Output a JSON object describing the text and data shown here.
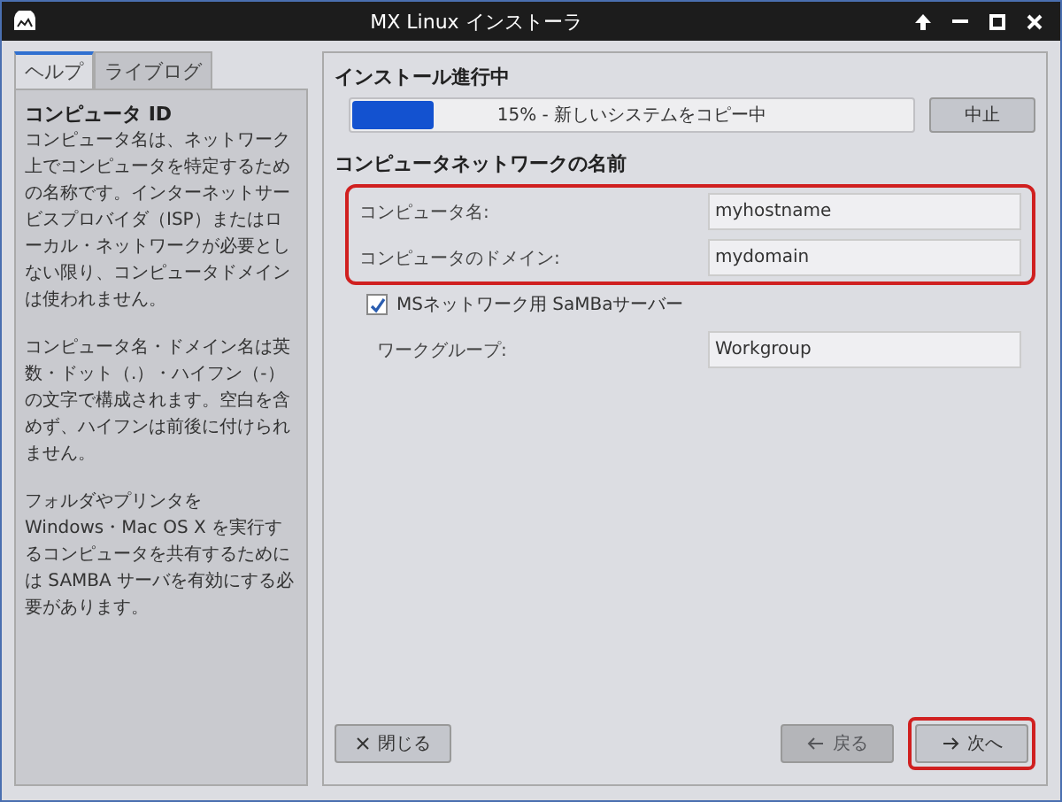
{
  "window": {
    "title": "MX Linux インストーラ"
  },
  "tabs": [
    {
      "label": "ヘルプ",
      "selected": true
    },
    {
      "label": "ライブログ",
      "selected": false
    }
  ],
  "help": {
    "title": "コンピュータ ID",
    "paragraphs": [
      "コンピュータ名は、ネットワーク上でコンピュータを特定するための名称です。インターネットサービスプロバイダ（ISP）またはローカル・ネットワークが必要としない限り、コンピュータドメインは使われません。",
      "コンピュータ名・ドメイン名は英数・ドット（.）・ハイフン（-）の文字で構成されます。空白を含めず、ハイフンは前後に付けられません。",
      "フォルダやプリンタを Windows・Mac OS X を実行するコンピュータを共有するためには SAMBA サーバを有効にする必要があります。"
    ]
  },
  "progress": {
    "heading": "インストール進行中",
    "level": 0.15,
    "text": "15% - 新しいシステムをコピー中",
    "abort": "中止"
  },
  "network": {
    "heading": "コンピュータネットワークの名前",
    "fields_highlighted": true,
    "fields": [
      {
        "label": "コンピュータ名:",
        "value": "myhostname"
      },
      {
        "label": "コンピュータのドメイン:",
        "value": "mydomain"
      }
    ],
    "samba": {
      "label": "MSネットワーク用 SaMBaサーバー",
      "checked": true
    },
    "workgroup": {
      "label": "ワークグループ:",
      "value": "Workgroup"
    }
  },
  "buttons": [
    {
      "label": "閉じる",
      "kind": "close",
      "disabled": false,
      "highlighted": false
    },
    {
      "label": "戻る",
      "kind": "back",
      "disabled": true,
      "highlighted": false
    },
    {
      "label": "次へ",
      "kind": "next",
      "disabled": false,
      "highlighted": true
    }
  ]
}
